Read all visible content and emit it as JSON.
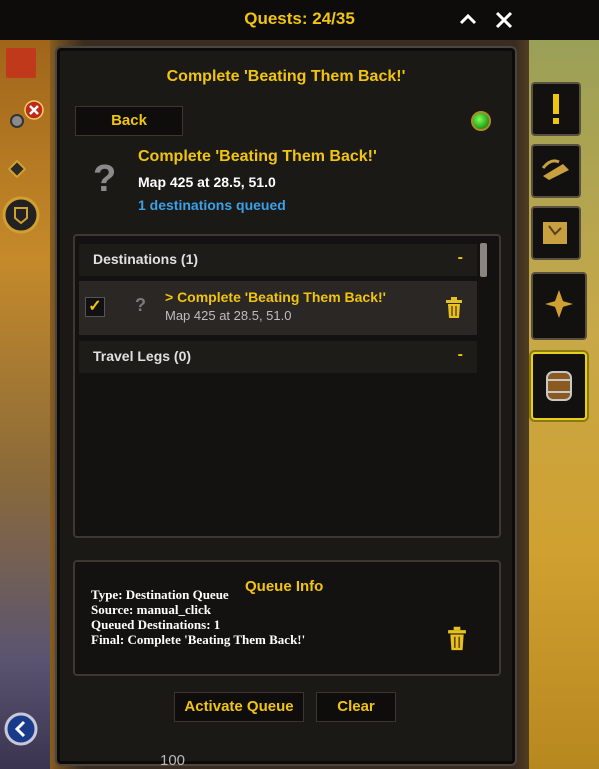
{
  "window": {
    "title": "Quests: 24/35",
    "collapse_icon": "chevron-up-icon",
    "close_icon": "close-icon"
  },
  "panel": {
    "title": "Complete 'Beating Them Back!'",
    "back_label": "Back",
    "status_color": "#2ecc40"
  },
  "quest": {
    "icon": "question-mark-icon",
    "title": "Complete 'Beating Them Back!'",
    "location": "Map 425 at 28.5, 51.0",
    "queued": "1 destinations queued"
  },
  "destinations": {
    "header": "Destinations (1)",
    "toggle": "-",
    "items": [
      {
        "checked": true,
        "title": "> Complete 'Beating Them Back!'",
        "location": "Map 425 at 28.5, 51.0"
      }
    ]
  },
  "travel_legs": {
    "header": "Travel Legs (0)",
    "toggle": "-"
  },
  "queue_info": {
    "title": "Queue Info",
    "lines": [
      "Type: Destination Queue",
      "Source: manual_click",
      "Queued Destinations: 1",
      "Final: Complete 'Beating Them Back!'"
    ]
  },
  "footer": {
    "activate_label": "Activate Queue",
    "clear_label": "Clear"
  },
  "right_tabs": [
    "exclamation-icon",
    "horn-icon",
    "map-scroll-icon",
    "compass-star-icon",
    "barrel-icon"
  ],
  "bottom_number": "100",
  "colors": {
    "accent": "#f1c40f",
    "link": "#3aa0e8"
  }
}
